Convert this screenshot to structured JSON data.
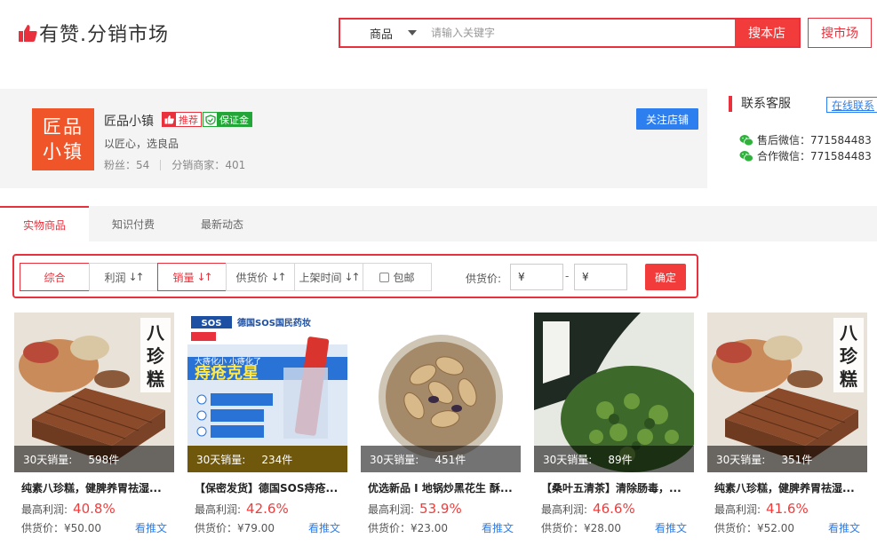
{
  "header": {
    "logo_text": "有赞.分销市场",
    "search_category": "商品",
    "search_placeholder": "请输入关键字",
    "search_shop_label": "搜本店",
    "search_market_label": "搜市场"
  },
  "shop": {
    "logo_line1": "匠品",
    "logo_line2": "小镇",
    "name": "匠品小镇",
    "badge_recommend": "推荐",
    "badge_guarantee": "保证金",
    "slogan": "以匠心，选良品",
    "fans_label": "粉丝：",
    "fans_value": "54",
    "dist_label": "分销商家：",
    "dist_value": "401",
    "follow_label": "关注店铺"
  },
  "service": {
    "title": "联系客服",
    "online_label": "在线联系",
    "after_sale": "售后微信：771584483",
    "cooperate": "合作微信：771584483"
  },
  "tabs": [
    {
      "label": "实物商品"
    },
    {
      "label": "知识付费"
    },
    {
      "label": "最新动态"
    }
  ],
  "filter": {
    "sort_all": "综合",
    "sort_profit": "利润",
    "sort_sales": "销量",
    "sort_price": "供货价",
    "sort_time": "上架时间",
    "free_ship": "包邮",
    "price_label": "供货价:",
    "price_min": "¥",
    "price_max": "¥",
    "dash": "-",
    "confirm": "确定"
  },
  "products": [
    {
      "sales_label": "30天销量:",
      "sales": "598件",
      "title": "纯素八珍糕，健脾养胃祛湿...",
      "profit_label": "最高利润:",
      "profit": "40.8%",
      "supply": "供货价：¥50.00",
      "promo": "看推文",
      "image_text": "八珍糕"
    },
    {
      "sales_label": "30天销量:",
      "sales": "234件",
      "title": "【保密发货】德国SOS痔疮...",
      "profit_label": "最高利润:",
      "profit": "42.6%",
      "supply": "供货价：¥79.00",
      "promo": "看推文",
      "image_text": "德国SOS国民药妆"
    },
    {
      "sales_label": "30天销量:",
      "sales": "451件",
      "title": "优选新品 I 地锅炒黑花生 酥...",
      "profit_label": "最高利润:",
      "profit": "53.9%",
      "supply": "供货价：¥23.00",
      "promo": "看推文"
    },
    {
      "sales_label": "30天销量:",
      "sales": "89件",
      "title": "【桑叶五清茶】清除肠毒，...",
      "profit_label": "最高利润:",
      "profit": "46.6%",
      "supply": "供货价：¥28.00",
      "promo": "看推文"
    },
    {
      "sales_label": "30天销量:",
      "sales": "351件",
      "title": "纯素八珍糕，健脾养胃祛湿...",
      "profit_label": "最高利润:",
      "profit": "41.6%",
      "supply": "供货价：¥52.00",
      "promo": "看推文",
      "image_text": "八珍糕"
    }
  ],
  "colors": {
    "accent": "#e8313c",
    "blue": "#2d7ff0",
    "logo_orange": "#f0552a",
    "green": "#23a638"
  }
}
